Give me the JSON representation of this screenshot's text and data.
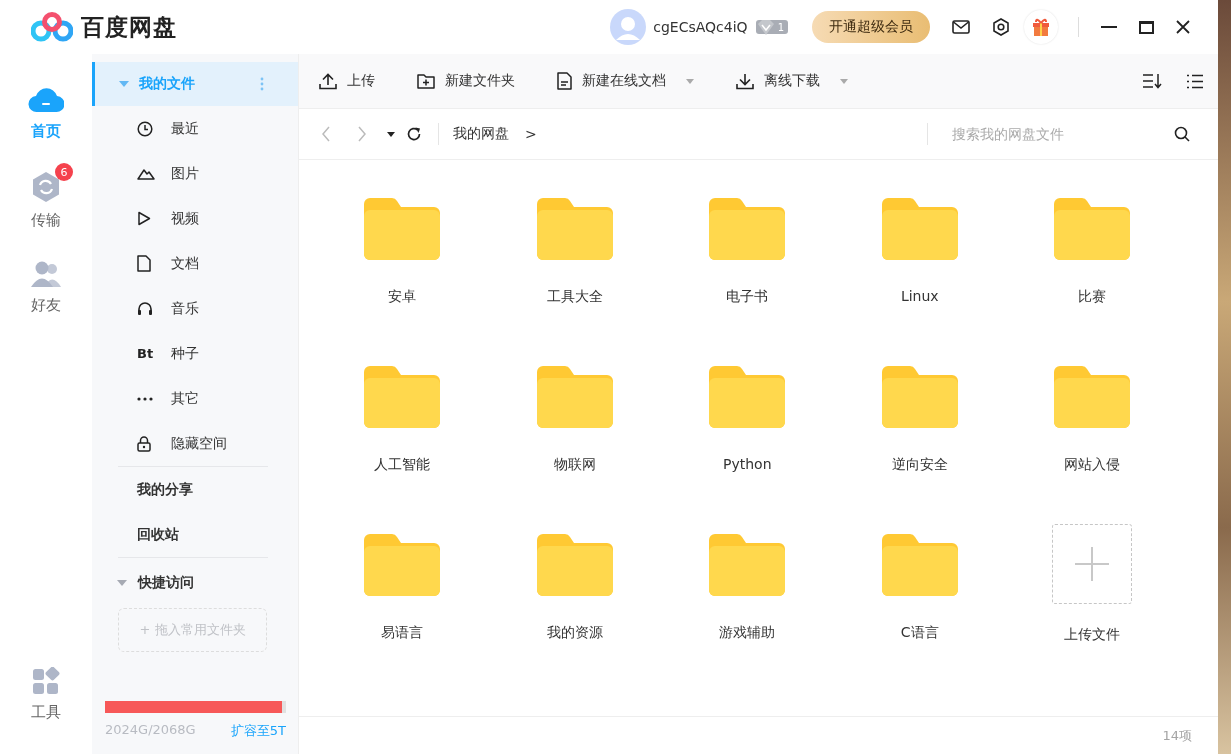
{
  "window": {
    "app_name": "百度网盘"
  },
  "user": {
    "name": "cgECsAQc4iQ",
    "vip_level": "1"
  },
  "vip_button": "开通超级会员",
  "nav": [
    {
      "label": "首页",
      "kind": "home",
      "selected": true
    },
    {
      "label": "传输",
      "kind": "transfer",
      "selected": false,
      "badge": "6"
    },
    {
      "label": "好友",
      "kind": "friends",
      "selected": false
    },
    {
      "label": "工具",
      "kind": "tools",
      "selected": false
    }
  ],
  "sidebar": {
    "section": {
      "label": "我的文件",
      "expanded": true,
      "selected": true
    },
    "items": [
      {
        "label": "最近",
        "kind": "recent"
      },
      {
        "label": "图片",
        "kind": "image"
      },
      {
        "label": "视频",
        "kind": "video"
      },
      {
        "label": "文档",
        "kind": "doc"
      },
      {
        "label": "音乐",
        "kind": "music"
      },
      {
        "label": "种子",
        "kind": "bt",
        "icon_text": "Bt"
      },
      {
        "label": "其它",
        "kind": "more"
      },
      {
        "label": "隐藏空间",
        "kind": "lock"
      }
    ],
    "links": [
      "我的分享",
      "回收站"
    ],
    "quick_access": {
      "label": "快捷访问",
      "expanded": true,
      "drop_hint": "+ 拖入常用文件夹"
    },
    "storage": {
      "level": 0.979,
      "usage": "2024G/2068G",
      "expand_link": "扩容至5T"
    }
  },
  "toolbar": [
    {
      "label": "上传",
      "kind": "upload",
      "dropdown": false
    },
    {
      "label": "新建文件夹",
      "kind": "new-folder",
      "dropdown": false
    },
    {
      "label": "新建在线文档",
      "kind": "doc",
      "dropdown": true
    },
    {
      "label": "离线下载",
      "kind": "download",
      "dropdown": true
    }
  ],
  "breadcrumb": {
    "path": [
      "我的网盘"
    ],
    "separator": ">"
  },
  "search": {
    "placeholder": "搜索我的网盘文件"
  },
  "files": [
    {
      "name": "安卓",
      "kind": "folder"
    },
    {
      "name": "工具大全",
      "kind": "folder"
    },
    {
      "name": "电子书",
      "kind": "folder"
    },
    {
      "name": "Linux",
      "kind": "folder"
    },
    {
      "name": "比赛",
      "kind": "folder"
    },
    {
      "name": "人工智能",
      "kind": "folder"
    },
    {
      "name": "物联网",
      "kind": "folder"
    },
    {
      "name": "Python",
      "kind": "folder"
    },
    {
      "name": "逆向安全",
      "kind": "folder"
    },
    {
      "name": "网站入侵",
      "kind": "folder"
    },
    {
      "name": "易语言",
      "kind": "folder"
    },
    {
      "name": "我的资源",
      "kind": "folder"
    },
    {
      "name": "游戏辅助",
      "kind": "folder"
    },
    {
      "name": "C语言",
      "kind": "folder"
    },
    {
      "name": "上传文件",
      "kind": "upload"
    }
  ],
  "status": "14项"
}
